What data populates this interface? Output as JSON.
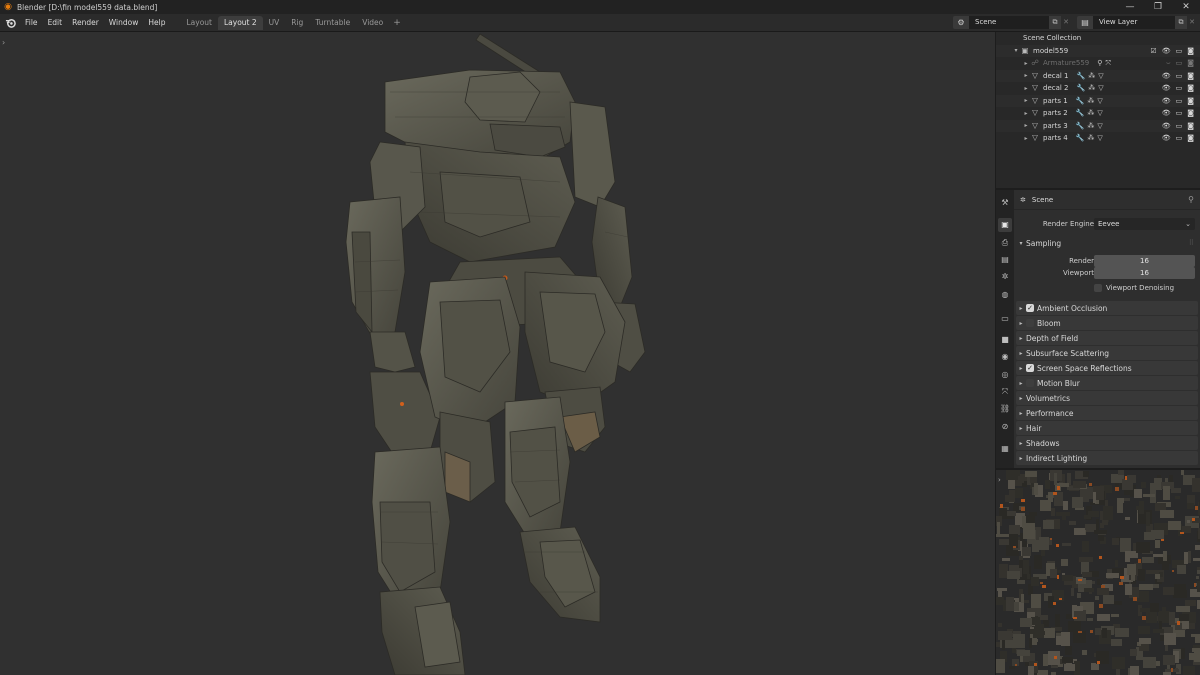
{
  "window": {
    "title": "Blender [D:\\fin model559 data.blend]",
    "controls": [
      "—",
      "❐",
      "✕"
    ]
  },
  "menu": [
    "File",
    "Edit",
    "Render",
    "Window",
    "Help"
  ],
  "workspaces": {
    "tabs": [
      "Layout",
      "Layout 2",
      "UV",
      "Rig",
      "Turntable",
      "Video"
    ],
    "active": "Layout 2",
    "add": "+"
  },
  "scene_selector": {
    "value": "Scene"
  },
  "view_layer_selector": {
    "value": "View Layer"
  },
  "outliner": {
    "root": "Scene Collection",
    "collection": "model559",
    "items": [
      {
        "name": "Armature559",
        "dim": true
      },
      {
        "name": "decal 1",
        "dim": false
      },
      {
        "name": "decal 2",
        "dim": false
      },
      {
        "name": "parts 1",
        "dim": false
      },
      {
        "name": "parts 2",
        "dim": false
      },
      {
        "name": "parts 3",
        "dim": false
      },
      {
        "name": "parts 4",
        "dim": false
      }
    ]
  },
  "properties": {
    "context": "Scene",
    "render_engine_label": "Render Engine",
    "render_engine_value": "Eevee",
    "sampling": {
      "title": "Sampling",
      "render_label": "Render",
      "render_value": "16",
      "viewport_label": "Viewport",
      "viewport_value": "16",
      "denoise_label": "Viewport Denoising"
    },
    "panels": [
      {
        "label": "Ambient Occlusion",
        "checkbox": true,
        "checked": true
      },
      {
        "label": "Bloom",
        "checkbox": true,
        "checked": false
      },
      {
        "label": "Depth of Field",
        "checkbox": false,
        "checked": false
      },
      {
        "label": "Subsurface Scattering",
        "checkbox": false,
        "checked": false
      },
      {
        "label": "Screen Space Reflections",
        "checkbox": true,
        "checked": true
      },
      {
        "label": "Motion Blur",
        "checkbox": true,
        "checked": false
      },
      {
        "label": "Volumetrics",
        "checkbox": false,
        "checked": false
      },
      {
        "label": "Performance",
        "checkbox": false,
        "checked": false
      },
      {
        "label": "Hair",
        "checkbox": false,
        "checked": false
      },
      {
        "label": "Shadows",
        "checkbox": false,
        "checked": false
      },
      {
        "label": "Indirect Lighting",
        "checkbox": false,
        "checked": false
      }
    ]
  },
  "colors": {
    "accent": "#e87d0d",
    "viewport_bg": "#303030",
    "panel_bg": "#2e2e2e",
    "model_surface": "#5b5a4f"
  }
}
